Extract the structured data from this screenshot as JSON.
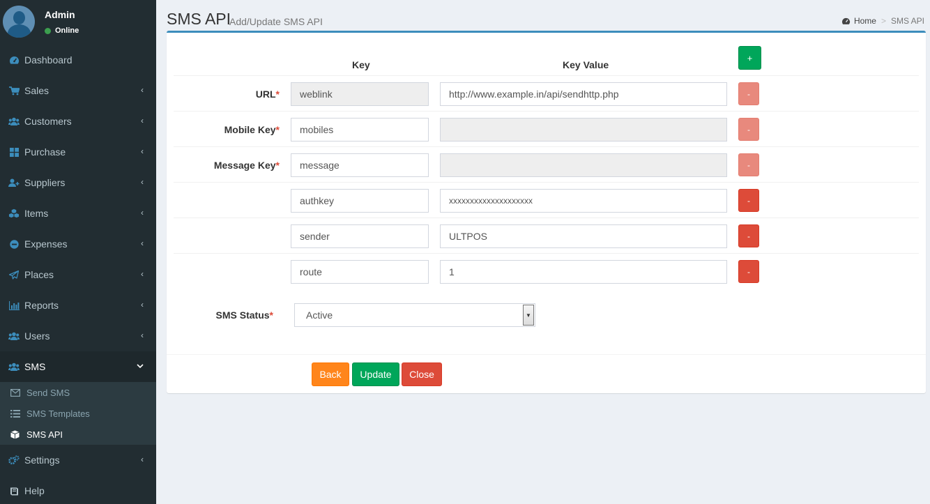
{
  "user": {
    "name": "Admin",
    "status": "Online"
  },
  "sidebar": {
    "items": [
      {
        "label": "Dashboard",
        "icon": "dashboard-icon"
      },
      {
        "label": "Sales",
        "icon": "cart-icon"
      },
      {
        "label": "Customers",
        "icon": "users-icon"
      },
      {
        "label": "Purchase",
        "icon": "grid-icon"
      },
      {
        "label": "Suppliers",
        "icon": "user-plus-icon"
      },
      {
        "label": "Items",
        "icon": "cubes-icon"
      },
      {
        "label": "Expenses",
        "icon": "minus-circle-icon"
      },
      {
        "label": "Places",
        "icon": "paper-plane-icon"
      },
      {
        "label": "Reports",
        "icon": "bar-chart-icon"
      },
      {
        "label": "Users",
        "icon": "users-icon"
      },
      {
        "label": "SMS",
        "icon": "users-icon"
      },
      {
        "label": "Settings",
        "icon": "cogs-icon"
      },
      {
        "label": "Help",
        "icon": "book-icon"
      }
    ],
    "sms_submenu": [
      {
        "label": "Send SMS",
        "icon": "envelope-icon"
      },
      {
        "label": "SMS Templates",
        "icon": "list-icon"
      },
      {
        "label": "SMS API",
        "icon": "cube-icon"
      }
    ]
  },
  "header": {
    "title": "SMS API",
    "subtitle": "Add/Update SMS API"
  },
  "breadcrumb": {
    "home": "Home",
    "current": "SMS API"
  },
  "form": {
    "col_key": "Key",
    "col_value": "Key Value",
    "add_label": "+",
    "remove_label": "-",
    "rows": [
      {
        "label": "URL",
        "key": "weblink",
        "value": "http://www.example.in/api/sendhttp.php"
      },
      {
        "label": "Mobile Key",
        "key": "mobiles",
        "value": ""
      },
      {
        "label": "Message Key",
        "key": "message",
        "value": ""
      },
      {
        "label": "",
        "key": "authkey",
        "value": "xxxxxxxxxxxxxxxxxxxx"
      },
      {
        "label": "",
        "key": "sender",
        "value": "ULTPOS"
      },
      {
        "label": "",
        "key": "route",
        "value": "1"
      }
    ],
    "required_mark": "*",
    "status_label": "SMS Status",
    "status_value": "Active"
  },
  "footer": {
    "back": "Back",
    "update": "Update",
    "close": "Close"
  },
  "colors": {
    "primary": "#3c8dbc",
    "success": "#00a65a",
    "danger": "#dd4b39",
    "warning": "#ff851b",
    "sidebar": "#222d32"
  }
}
